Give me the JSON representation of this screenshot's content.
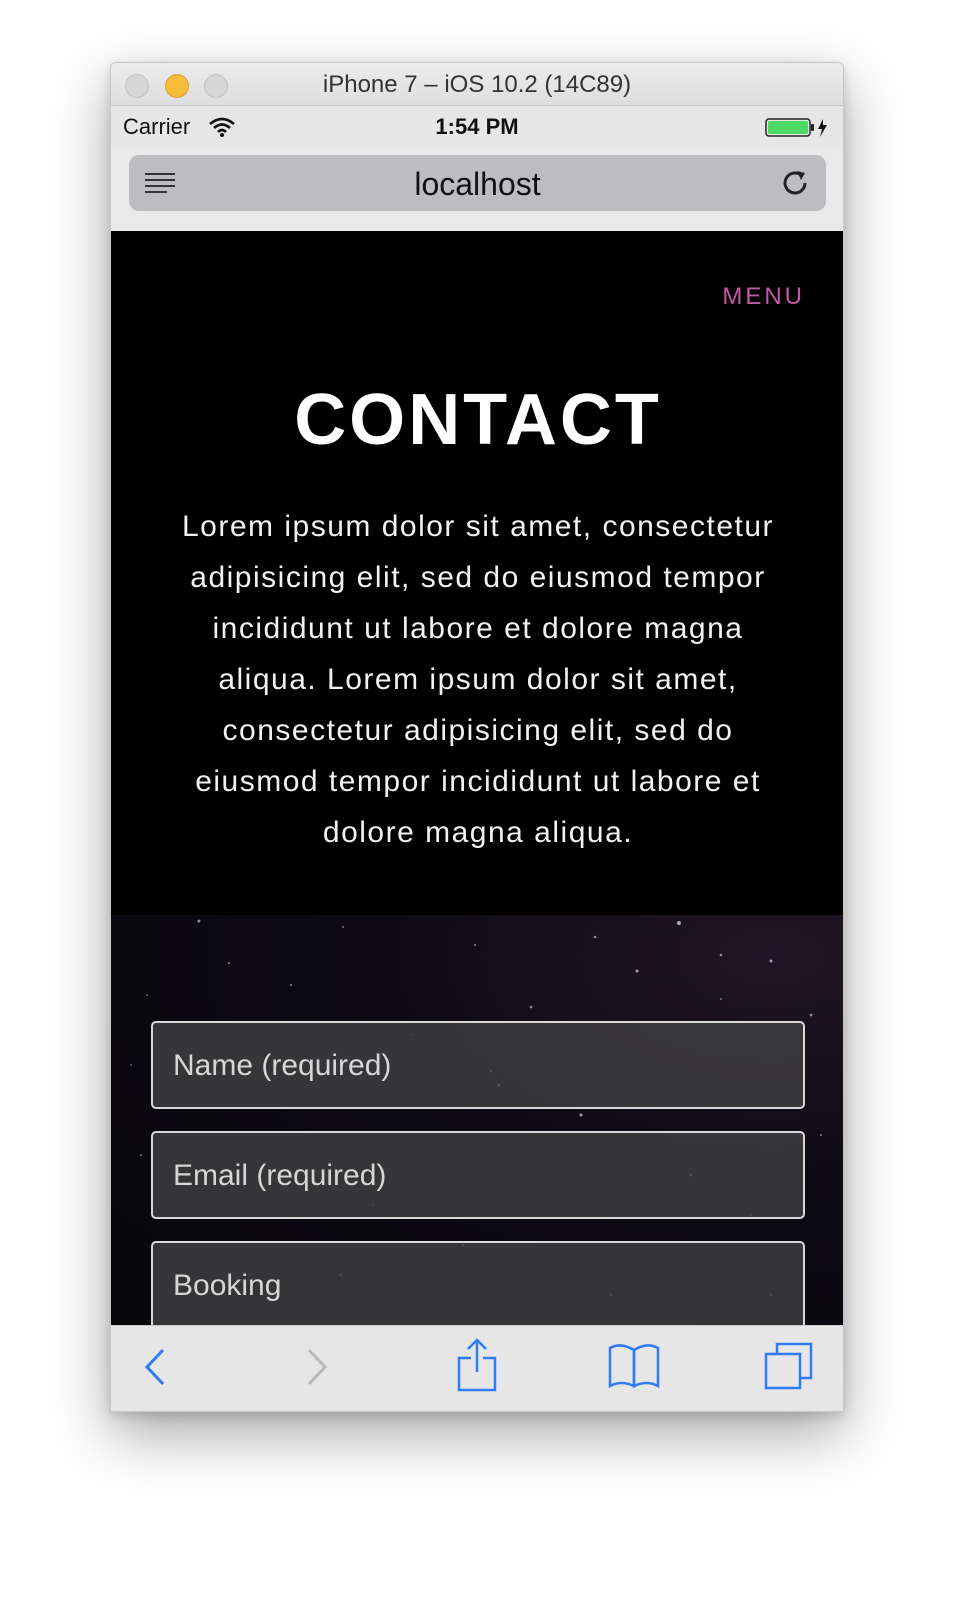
{
  "window": {
    "title": "iPhone 7 – iOS 10.2 (14C89)"
  },
  "status_bar": {
    "carrier": "Carrier",
    "time": "1:54 PM",
    "battery_color": "#4cd964"
  },
  "address_bar": {
    "url": "localhost"
  },
  "page": {
    "menu_label": "MENU",
    "menu_color": "#c45aa6",
    "title": "CONTACT",
    "intro": "Lorem ipsum dolor sit amet, consectetur adipisicing elit, sed do eiusmod tempor incididunt ut labore et dolore magna aliqua. Lorem ipsum dolor sit amet, consectetur adipisicing elit, sed do eiusmod tempor incididunt ut labore et dolore magna aliqua."
  },
  "form": {
    "name_placeholder": "Name (required)",
    "email_placeholder": "Email (required)",
    "booking_placeholder": "Booking"
  },
  "toolbar": {
    "icons": [
      "back-icon",
      "forward-icon",
      "share-icon",
      "bookmarks-icon",
      "tabs-icon"
    ],
    "accent_color": "#2f7cf6"
  }
}
